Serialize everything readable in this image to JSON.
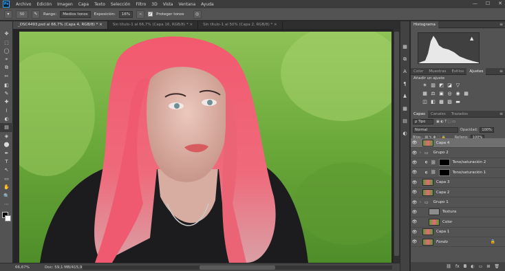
{
  "app": {
    "logo": "Ps"
  },
  "menu": [
    "Archivo",
    "Edición",
    "Imagen",
    "Capa",
    "Texto",
    "Selección",
    "Filtro",
    "3D",
    "Vista",
    "Ventana",
    "Ayuda"
  ],
  "window_controls": {
    "minimize": "—",
    "maximize": "☐",
    "close": "✕"
  },
  "options": {
    "brush_size": "50",
    "range_label": "Rango:",
    "range_value": "Medios tonos",
    "exposure_label": "Exposición:",
    "exposure_value": "16%",
    "protect_label": "Proteger tonos",
    "protect_checked": "✓"
  },
  "doc_tabs": [
    "_DSC4493.psd al 66,7% (Capa 4, RGB/8) * ×",
    "Sin título-1 al 66,7% (Capa 16, RGB/8) * ×",
    "Sin título-1 al 50% (Capa 2, RGB/8) * ×"
  ],
  "status": {
    "zoom": "66,67%",
    "doc": "Doc: 59,1 MB/415,9 MB",
    "arrow": ">"
  },
  "tools": [
    "✥",
    "⬚",
    "◯",
    "⌖",
    "⧉",
    "✂",
    "◧",
    "✎",
    "✚",
    "⌇",
    "◐",
    "▤",
    "◈",
    "⬤",
    "✒",
    "T",
    "↖",
    "▭",
    "✋",
    "🔍",
    "⋯"
  ],
  "dock_icons": [
    "▦",
    "⧉",
    "A",
    "¶",
    "♟",
    "▦",
    "▤",
    "◐"
  ],
  "histogram": {
    "tab": "Histograma",
    "warning": "▲",
    "menu": "≡"
  },
  "adjust": {
    "tabs": [
      "Color",
      "Muestras",
      "Estilos",
      "Ajustes"
    ],
    "title": "Añadir un ajuste",
    "row1": [
      "☀",
      "▥",
      "◩",
      "◪",
      "▽"
    ],
    "row2": [
      "▦",
      "⚖",
      "▣",
      "◎",
      "◉",
      "▦"
    ],
    "row3": [
      "◫",
      "◧",
      "▩",
      "▨",
      "▬"
    ]
  },
  "layers": {
    "tabs": [
      "Capas",
      "Canales",
      "Trazados"
    ],
    "filter_label": "ρ Tipo",
    "blend_mode": "Normal",
    "opacity_label": "Opacidad:",
    "opacity_value": "100%",
    "lock_label": "Bloq.:",
    "fill_label": "Relleno:",
    "fill_value": "100%",
    "items": [
      {
        "name": "Capa 4",
        "kind": "photo",
        "indent": 0,
        "selected": true
      },
      {
        "name": "Grupo 2",
        "kind": "group",
        "indent": 0
      },
      {
        "name": "Tono/saturación 2",
        "kind": "adjust",
        "indent": 1
      },
      {
        "name": "Tono/saturación 1",
        "kind": "adjust",
        "indent": 1
      },
      {
        "name": "Capa 3",
        "kind": "photo",
        "indent": 0
      },
      {
        "name": "Capa 2",
        "kind": "photo",
        "indent": 0
      },
      {
        "name": "Grupo 1",
        "kind": "group",
        "indent": 0
      },
      {
        "name": "Textura",
        "kind": "gray",
        "indent": 1
      },
      {
        "name": "Color",
        "kind": "photo",
        "indent": 1
      },
      {
        "name": "Capa 1",
        "kind": "photo",
        "indent": 0
      },
      {
        "name": "Fondo",
        "kind": "photo",
        "indent": 0,
        "italic": true,
        "locked": true
      }
    ],
    "footer": [
      "⛓",
      "fx",
      "◘",
      "◐",
      "▭",
      "⊞",
      "🗑"
    ]
  }
}
